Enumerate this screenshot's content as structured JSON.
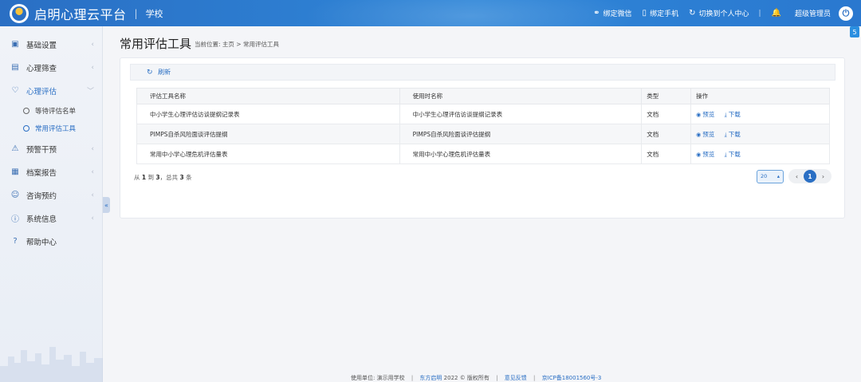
{
  "header": {
    "brand": "启明心理云平台",
    "separator": "|",
    "school": "学校",
    "actions": [
      {
        "icon": "wechat-icon",
        "glyph": "⚭",
        "label": "绑定微信"
      },
      {
        "icon": "phone-icon",
        "glyph": "▯",
        "label": "绑定手机"
      },
      {
        "icon": "switch-icon",
        "glyph": "↻",
        "label": "切换到个人中心"
      }
    ],
    "divider": "|",
    "bell_glyph": "🔔",
    "user": "超级管理员",
    "power_glyph": "⏻"
  },
  "sidebar": {
    "items": [
      {
        "label": "基础设置",
        "icon": "settings-box-icon",
        "glyph": "▣"
      },
      {
        "label": "心理筛查",
        "icon": "screening-icon",
        "glyph": "▤"
      },
      {
        "label": "心理评估",
        "icon": "heart-icon",
        "glyph": "♡"
      },
      {
        "label": "预警干预",
        "icon": "warning-icon",
        "glyph": "⚠"
      },
      {
        "label": "档案报告",
        "icon": "archive-icon",
        "glyph": "▦"
      },
      {
        "label": "咨询预约",
        "icon": "chat-icon",
        "glyph": "☺"
      },
      {
        "label": "系统信息",
        "icon": "info-icon",
        "glyph": "ⓘ"
      },
      {
        "label": "帮助中心",
        "icon": "help-icon",
        "glyph": "?"
      }
    ],
    "sub_items": [
      {
        "label": "等待评估名单"
      },
      {
        "label": "常用评估工具"
      }
    ],
    "arrow": "‹",
    "arrow_open": "﹀",
    "collapse_glyph": "«"
  },
  "page": {
    "title": "常用评估工具",
    "breadcrumb": "当前位置: 主页 > 常用评估工具"
  },
  "toolbar": {
    "refresh_glyph": "↻",
    "refresh_label": "刷新"
  },
  "table": {
    "headers": [
      "评估工具名称",
      "使用时名称",
      "类型",
      "操作"
    ],
    "rows": [
      {
        "name": "中小学生心理评估访谈提纲记录表",
        "use_name": "中小学生心理评估访谈提纲记录表",
        "type": "文档"
      },
      {
        "name": "PIMPS自杀风险面谈评估提纲",
        "use_name": "PIMPS自杀风险面谈评估提纲",
        "type": "文档"
      },
      {
        "name": "常用中小学心理危机评估量表",
        "use_name": "常用中小学心理危机评估量表",
        "type": "文档"
      }
    ],
    "preview_label": "预览",
    "download_label": "下载",
    "preview_glyph": "◉",
    "download_glyph": "⤓"
  },
  "pagination": {
    "summary_prefix": "从",
    "from": "1",
    "to_word": "到",
    "to": "3",
    "total_word": "，总共",
    "total": "3",
    "unit": "条",
    "page_size": "20",
    "size_caret": "▴",
    "prev": "‹",
    "current": "1",
    "next": "›"
  },
  "footer": {
    "unit_label": "使用单位: 演示用学校",
    "sep": "|",
    "company": "东方启明",
    "copyright": "2022 © 版权所有",
    "feedback": "意见反馈",
    "icp": "京ICP备18001560号-3"
  },
  "side_badge": "5"
}
